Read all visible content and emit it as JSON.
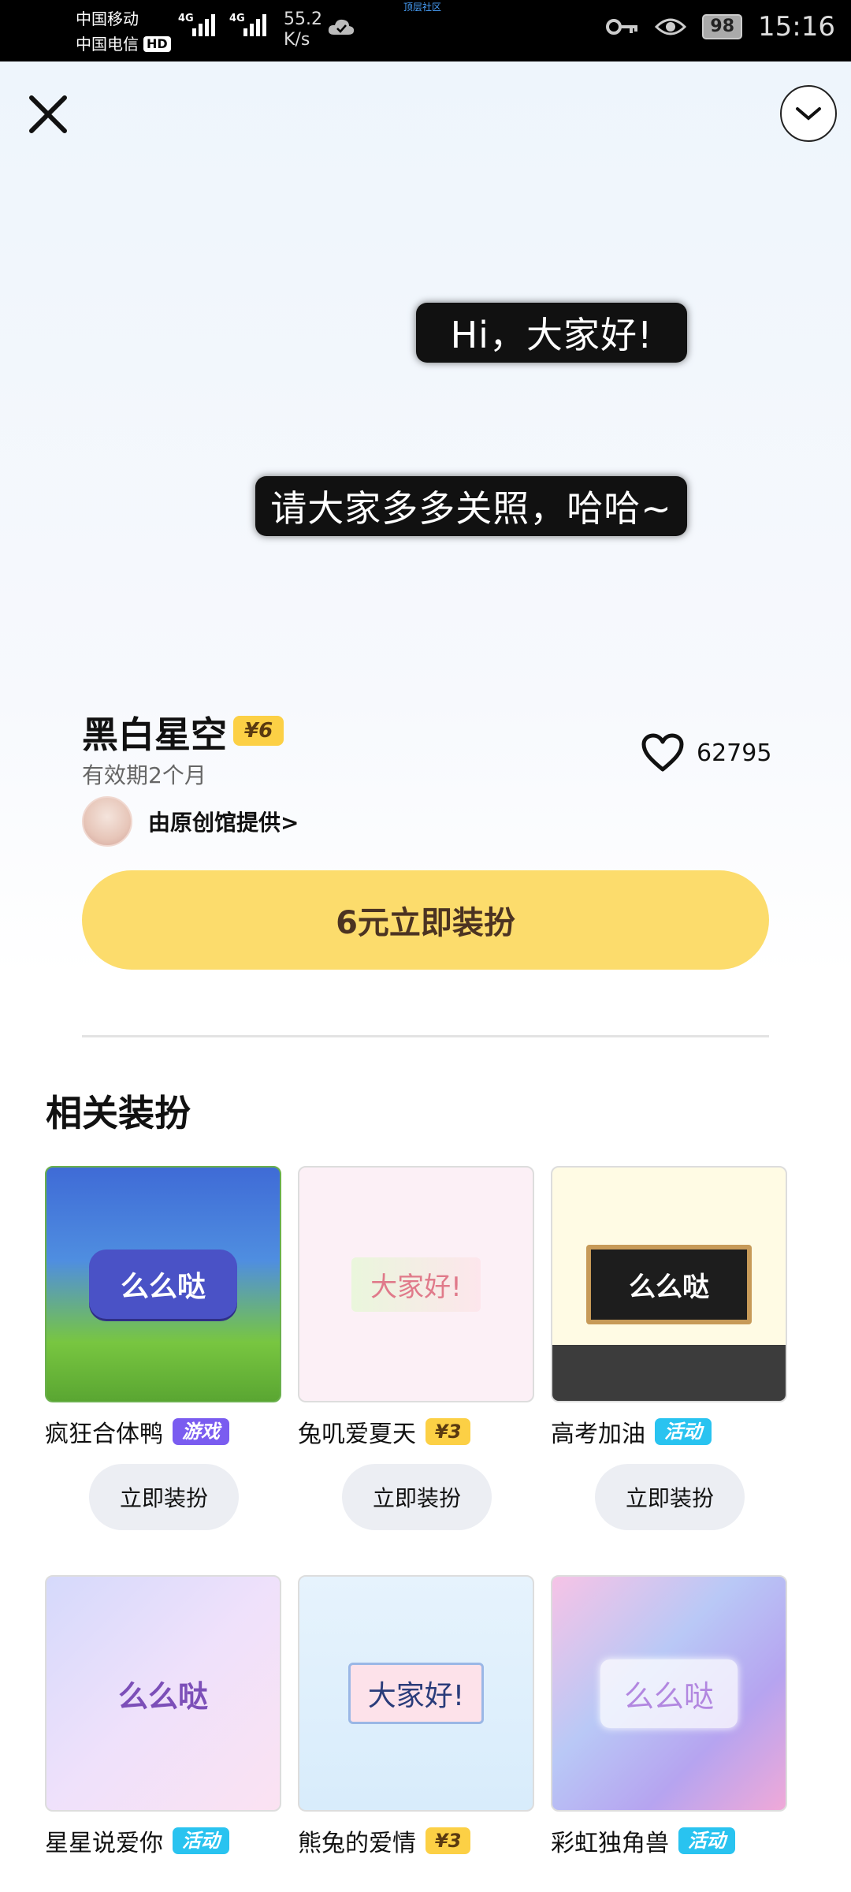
{
  "status_bar": {
    "carrier1": "中国移动",
    "carrier2": "中国电信",
    "hd": "HD",
    "net1": "4G",
    "net2": "4G",
    "speed": "55.2",
    "speed_unit": "K/s",
    "mid_text": "顶层社区",
    "battery": "98",
    "time": "15:16"
  },
  "preview": {
    "bubble1": "Hi，大家好!",
    "bubble2": "请大家多多关照，哈哈~"
  },
  "item": {
    "title": "黑白星空",
    "price": "¥6",
    "validity": "有效期2个月",
    "provider": "由原创馆提供>",
    "likes": "62795",
    "cta": "6元立即装扮"
  },
  "related": {
    "title": "相关装扮",
    "items": [
      {
        "name": "疯狂合体鸭",
        "tag": "游戏",
        "preview_text": "么么哒",
        "button": "立即装扮"
      },
      {
        "name": "兔叽爱夏天",
        "tag": "¥3",
        "preview_text": "大家好!",
        "button": "立即装扮"
      },
      {
        "name": "高考加油",
        "tag": "活动",
        "preview_text": "么么哒",
        "button": "立即装扮"
      },
      {
        "name": "星星说爱你",
        "tag": "活动",
        "preview_text": "么么哒"
      },
      {
        "name": "熊兔的爱情",
        "tag": "¥3",
        "preview_text": "大家好!"
      },
      {
        "name": "彩虹独角兽",
        "tag": "活动",
        "preview_text": "么么哒"
      }
    ]
  },
  "colors": {
    "cta": "#fcdc6c",
    "price_badge": "#fcd045",
    "tag_game": "#7a5cf0",
    "tag_event": "#29c3f0"
  },
  "icons": [
    "close-icon",
    "chevron-down-icon",
    "heart-icon",
    "cloud-icon",
    "key-icon",
    "eye-icon"
  ]
}
